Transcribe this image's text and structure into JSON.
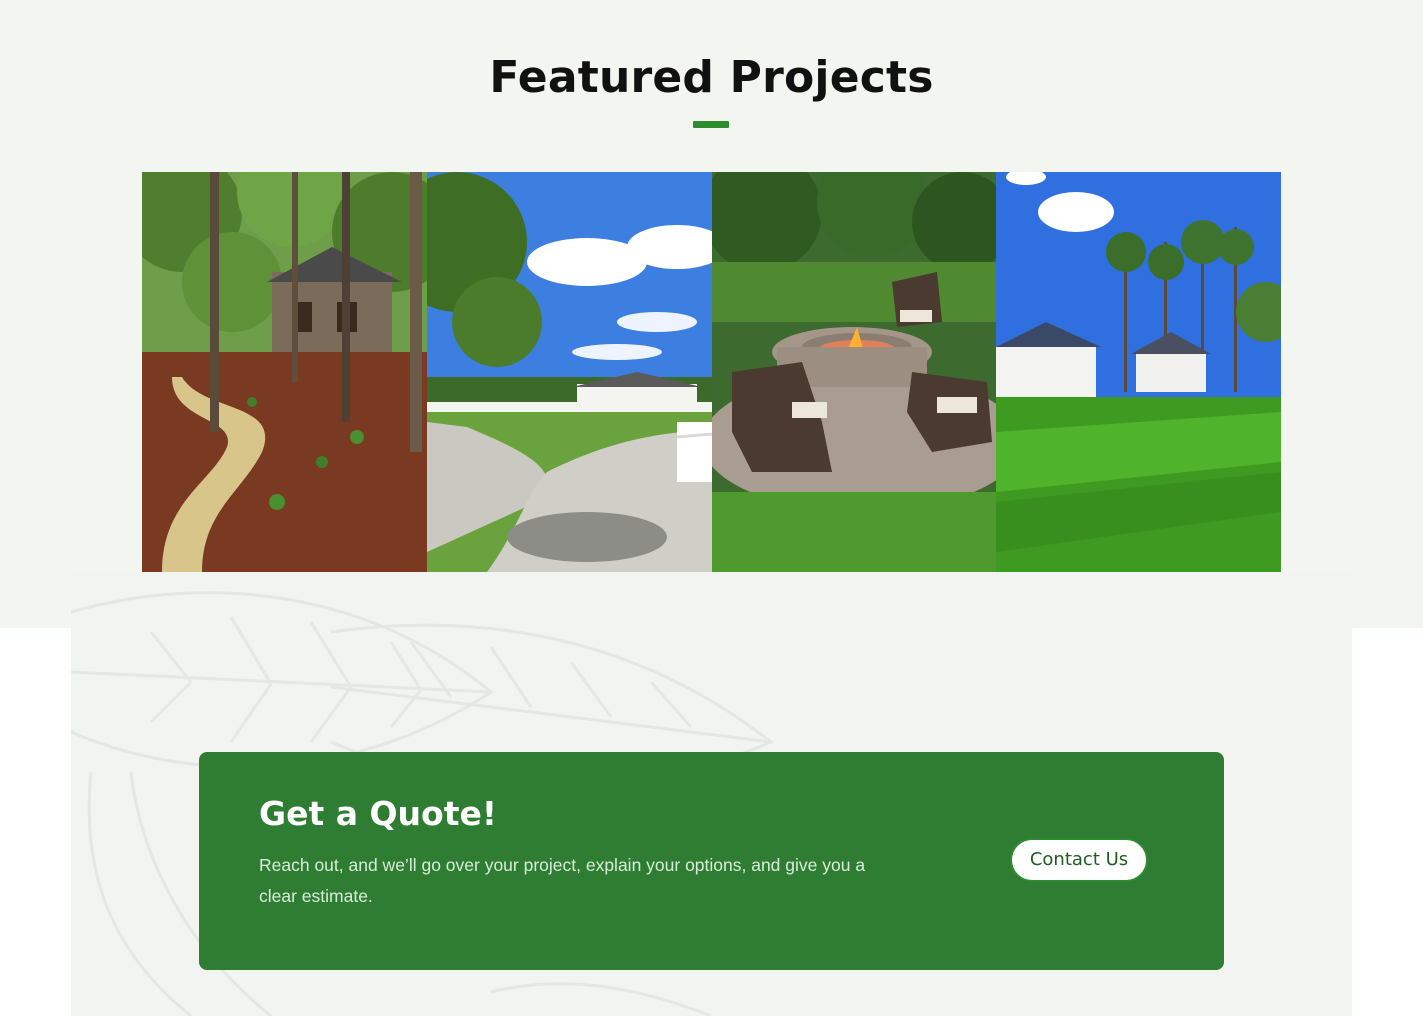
{
  "featured": {
    "title": "Featured Projects",
    "accent_color": "#2e8b2e",
    "projects": [
      {
        "subject": "wooded home with mulch beds and stone path"
      },
      {
        "subject": "gravel driveway leading to white farmhouse"
      },
      {
        "subject": "paver patio with round fire pit and wicker chairs"
      },
      {
        "subject": "new lawn behind white house with pine trees"
      }
    ]
  },
  "cta": {
    "title": "Get a Quote!",
    "text": "Reach out, and we’ll go over your project, explain your options, and give you a clear estimate.",
    "button_label": "Contact Us",
    "background_color": "#2e7d32"
  }
}
